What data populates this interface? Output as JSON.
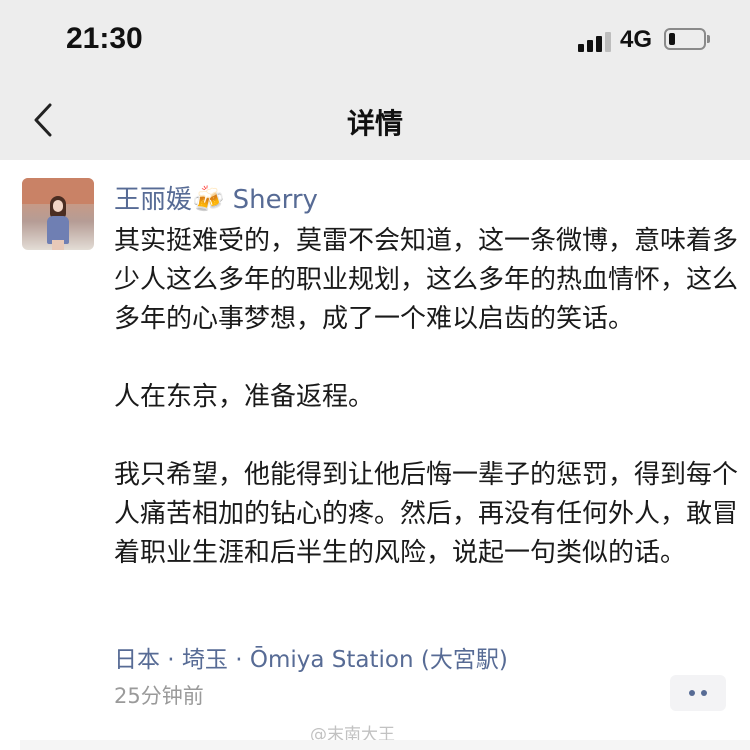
{
  "status_bar": {
    "time": "21:30",
    "network": "4G",
    "battery_level": 0.2
  },
  "nav": {
    "title": "详情",
    "back_icon": "chevron-left-icon"
  },
  "post": {
    "author": "王丽媛🍻 Sherry",
    "paragraphs": [
      "其实挺难受的，莫雷不会知道，这一条微博，意味着多少人这么多年的职业规划，这么多年的热血情怀，这么多年的心事梦想，成了一个难以启齿的笑话。",
      "人在东京，准备返程。",
      "我只希望，他能得到让他后悔一辈子的惩罚，得到每个人痛苦相加的钻心的疼。然后，再没有任何外人，敢冒着职业生涯和后半生的风险，说起一句类似的话。"
    ],
    "location": "日本 · 埼玉 · Ōmiya Station (大宮駅)",
    "time_ago": "25分钟前"
  },
  "watermark": "@末南大王",
  "colors": {
    "link": "#576b95",
    "header_bg": "#ededed",
    "meta_text": "#9a9a9a"
  }
}
